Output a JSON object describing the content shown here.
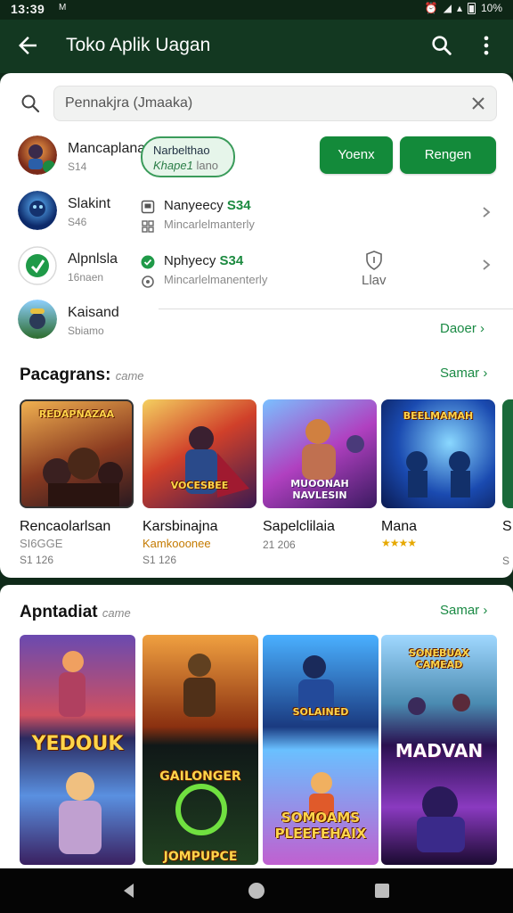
{
  "status": {
    "time": "13:39",
    "carrier": "M",
    "battery": "10%"
  },
  "appbar": {
    "title": "Toko Aplik Uagan"
  },
  "search": {
    "placeholder": "Pennakjra (Jmaaka)",
    "value": "Pennakjra (Jmaaka)"
  },
  "rows": [
    {
      "name": "Mancaplana",
      "sub": "S14"
    },
    {
      "name": "Slakint",
      "sub": "S46"
    },
    {
      "name": "Alpnlsla",
      "sub": "16naen"
    },
    {
      "name": "Kaisand",
      "sub": "Sbiamo"
    }
  ],
  "chip": {
    "line1": "Narbelthao",
    "line2_a": "Khape1",
    "line2_b": "lano"
  },
  "buttons": {
    "primary": "Yoenx",
    "secondary": "Rengen"
  },
  "info": [
    {
      "title": "Nanyeecy",
      "badge": "S34",
      "sub": "Mincarlelmanterly"
    },
    {
      "title": "Nphyecy",
      "badge": "S34",
      "sub": "Mincarlelmanenterly"
    }
  ],
  "lbl_flav": "Llav",
  "link_daoer": "Daoer",
  "section1": {
    "title": "Pacagrans:",
    "subtitle": "came",
    "link": "Samar"
  },
  "games": [
    {
      "name": "Rencaolarlsan",
      "sub": "SI6GGE",
      "size": "S1 126",
      "art": "REDAPNAZAA"
    },
    {
      "name": "Karsbinajna",
      "sub": "Kamkooonee",
      "size": "S1 126",
      "art": "VOCESBEE"
    },
    {
      "name": "Sapelclilaia",
      "sub": "",
      "size": "21 206",
      "art": "MUOONAH NAVLESIN"
    },
    {
      "name": "Mana",
      "sub": "★★★★",
      "size": "",
      "art": "BEELMAMAH"
    },
    {
      "name": "S",
      "sub": "",
      "size": "S",
      "art": ""
    }
  ],
  "section2": {
    "title": "Apntadiat",
    "subtitle": "came",
    "link": "Samar"
  },
  "tiles": [
    {
      "top": "",
      "bottom": "YEDOUK"
    },
    {
      "top": "",
      "bottom": "GAILONGER JOMPUPCE"
    },
    {
      "top": "SOLAINED",
      "bottom": "SOMOAMS PLEEFEHAIX"
    },
    {
      "top": "SONEBUAX CAMEAD",
      "bottom": "MADVAN"
    }
  ],
  "colors": {
    "brand_green": "#138a3a",
    "appbar": "#133821",
    "accent_link": "#1a8a44"
  },
  "icons": [
    "back-arrow-icon",
    "search-icon",
    "more-vert-icon",
    "clear-icon",
    "chevron-right-icon",
    "nav-back-icon",
    "nav-home-icon",
    "nav-recents-icon"
  ]
}
